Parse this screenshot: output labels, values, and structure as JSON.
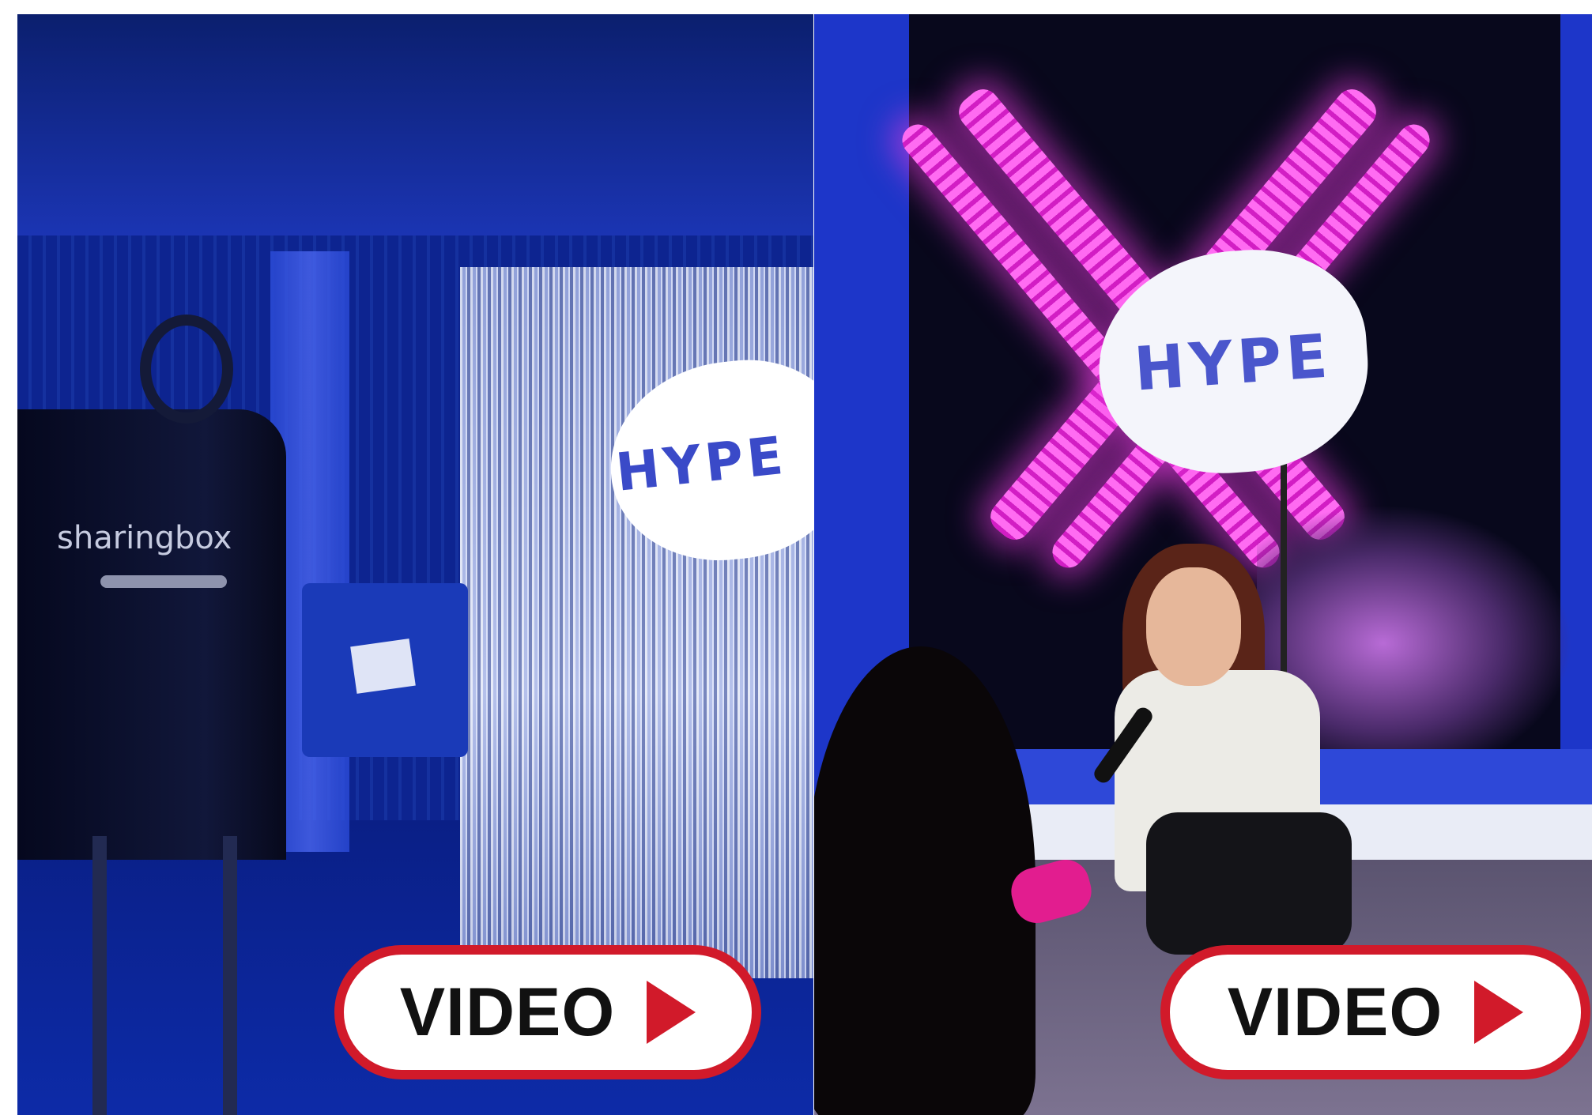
{
  "left_photo": {
    "sign_text": "HYPE",
    "booth_brand": "sharingbox"
  },
  "right_photo": {
    "sign_text": "HYPE"
  },
  "video_buttons": [
    {
      "label": "VIDEO"
    },
    {
      "label": "VIDEO"
    }
  ],
  "colors": {
    "button_border": "#d11a2a",
    "play_icon": "#d11a2a",
    "button_text": "#111111"
  }
}
